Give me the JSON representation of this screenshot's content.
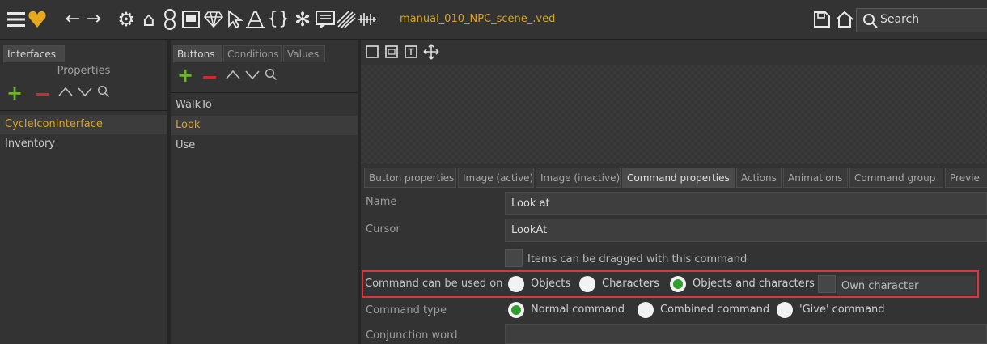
{
  "toolbar": {
    "project_name": "manual_010_NPC_scene_.ved",
    "search_placeholder": "Search",
    "icons": [
      "menu-icon",
      "logo-heart-icon",
      "back-arrow-icon",
      "forward-arrow-icon",
      "settings-gear-icon",
      "home-scene-icon",
      "persons-icon",
      "dialog-icon",
      "diamond-icon",
      "cursor-icon",
      "font-icon",
      "braces-icon",
      "particles-icon",
      "text-lines-icon",
      "hatch-icon",
      "audio-icon",
      "save-icon",
      "home-icon",
      "search-icon"
    ]
  },
  "left_panel": {
    "tab": "Interfaces",
    "header": "Properties",
    "items": [
      {
        "label": "CycleIconInterface",
        "selected": true
      },
      {
        "label": "Inventory",
        "selected": false
      }
    ]
  },
  "middle_panel": {
    "tabs": [
      {
        "label": "Buttons",
        "active": true
      },
      {
        "label": "Conditions",
        "active": false
      },
      {
        "label": "Values",
        "active": false
      }
    ],
    "items": [
      {
        "label": "WalkTo",
        "selected": false
      },
      {
        "label": "Look",
        "selected": true
      },
      {
        "label": "Use",
        "selected": false
      }
    ]
  },
  "right_panel": {
    "tool_icons": [
      "select-rect-icon",
      "image-rect-icon",
      "text-rect-icon",
      "move-icon"
    ],
    "tabs": [
      {
        "label": "Button properties",
        "active": false
      },
      {
        "label": "Image (active)",
        "active": false
      },
      {
        "label": "Image (inactive)",
        "active": false
      },
      {
        "label": "Command properties",
        "active": true
      },
      {
        "label": "Actions",
        "active": false
      },
      {
        "label": "Animations",
        "active": false
      },
      {
        "label": "Command group",
        "active": false
      },
      {
        "label": "Previe",
        "active": false
      }
    ],
    "fields": {
      "name_label": "Name",
      "name_value": "Look at",
      "cursor_label": "Cursor",
      "cursor_value": "LookAt",
      "drag_checkbox_label": "Items can be dragged with this command",
      "usable_on_label": "Command can be used on",
      "usable_on_options": [
        {
          "label": "Objects",
          "selected": false
        },
        {
          "label": "Characters",
          "selected": false
        },
        {
          "label": "Objects and characters",
          "selected": true
        }
      ],
      "own_character_label": "Own character",
      "command_type_label": "Command type",
      "command_type_options": [
        {
          "label": "Normal command",
          "selected": true
        },
        {
          "label": "Combined command",
          "selected": false
        },
        {
          "label": "'Give' command",
          "selected": false
        }
      ],
      "conjunction_label": "Conjunction word",
      "conjunction_value": ""
    }
  },
  "colors": {
    "accent_orange": "#d9a32a",
    "add_green": "#6ab82a",
    "remove_red": "#d02a2a",
    "radio_green": "#2f9e2f",
    "highlight_red": "#d9393a"
  }
}
